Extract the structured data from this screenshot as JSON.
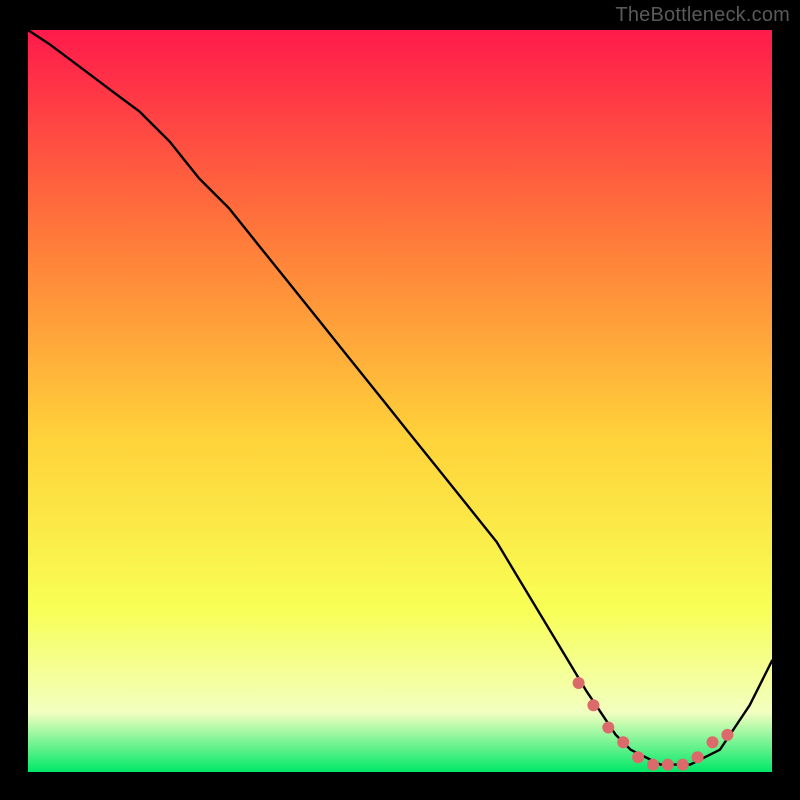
{
  "attribution": "TheBottleneck.com",
  "colors": {
    "gradient_top": "#ff1a4b",
    "gradient_upper_mid": "#ff7a3a",
    "gradient_mid": "#ffd23a",
    "gradient_lower_mid": "#f8ff55",
    "gradient_low": "#f2ffc0",
    "gradient_bottom": "#00e867",
    "curve": "#000000",
    "marker": "#dd6a6a",
    "frame_bg": "#000000"
  },
  "chart_data": {
    "type": "line",
    "title": "",
    "xlabel": "",
    "ylabel": "",
    "xlim": [
      0,
      100
    ],
    "ylim": [
      0,
      100
    ],
    "series": [
      {
        "name": "bottleneck-curve",
        "x": [
          0,
          3,
          7,
          11,
          15,
          19,
          23,
          27,
          31,
          35,
          39,
          43,
          47,
          51,
          55,
          59,
          63,
          66,
          69,
          72,
          75,
          77,
          79,
          81,
          83,
          85,
          87,
          89,
          91,
          93,
          95,
          97,
          99,
          100
        ],
        "y": [
          100,
          98,
          95,
          92,
          89,
          85,
          80,
          76,
          71,
          66,
          61,
          56,
          51,
          46,
          41,
          36,
          31,
          26,
          21,
          16,
          11,
          8,
          5,
          3,
          2,
          1,
          1,
          1,
          2,
          3,
          6,
          9,
          13,
          15
        ]
      }
    ],
    "markers": {
      "name": "highlighted-region",
      "x": [
        74,
        76,
        78,
        80,
        82,
        84,
        86,
        88,
        90,
        92,
        94
      ],
      "y": [
        12,
        9,
        6,
        4,
        2,
        1,
        1,
        1,
        2,
        4,
        5
      ]
    }
  }
}
